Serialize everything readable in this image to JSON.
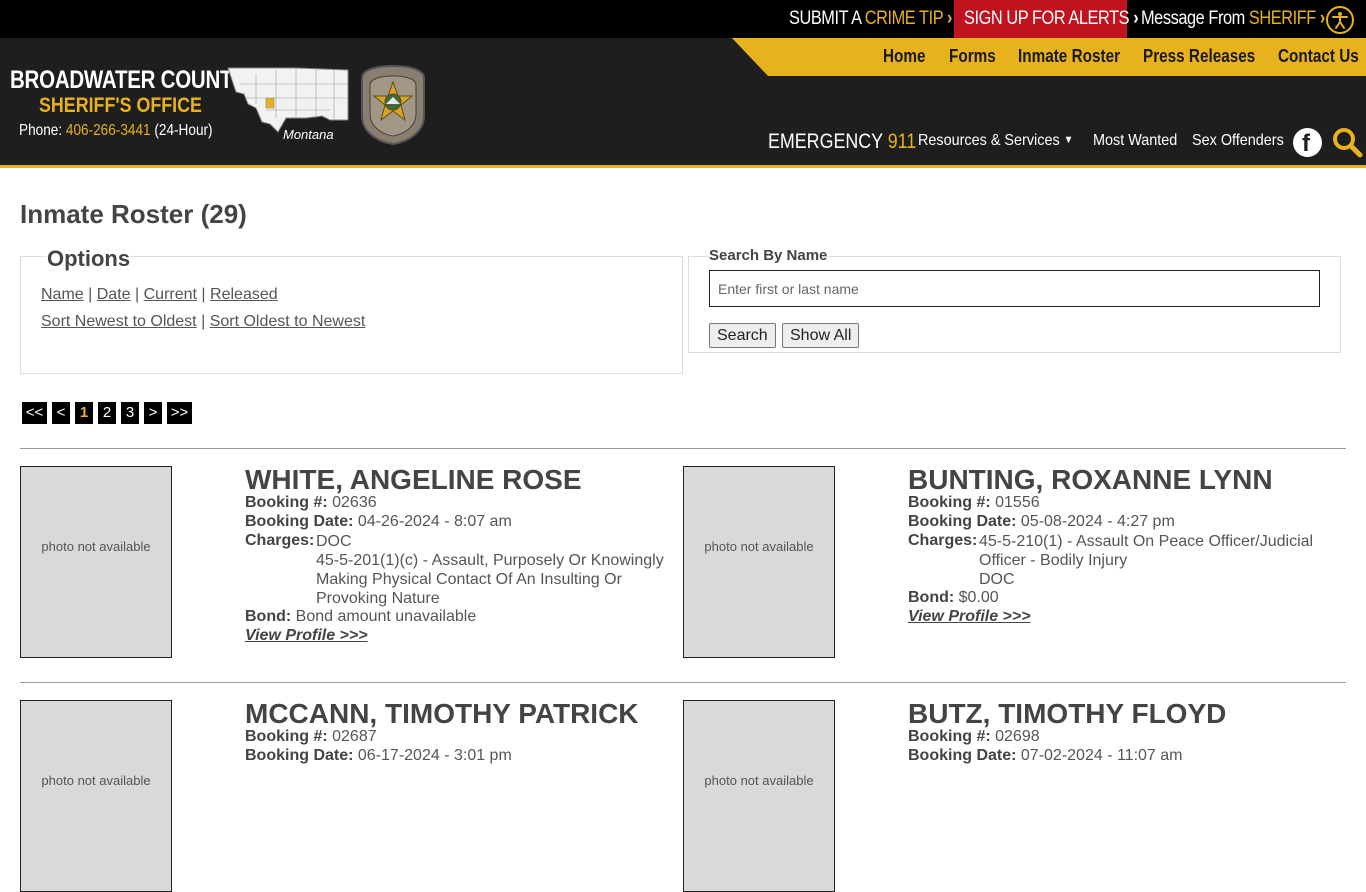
{
  "topbar": {
    "crime_tip_a": "SUBMIT A",
    "crime_tip_b": "CRIME TIP",
    "alerts": "SIGN UP FOR ALERTS",
    "message_a": "Message From",
    "message_b": "SHERIFF",
    "chevron": "›"
  },
  "brand": {
    "line1": "BROADWATER COUNTY",
    "line2": "SHERIFF'S OFFICE",
    "phone_label": "Phone:",
    "phone": "406-266-3441",
    "phone_note": "(24-Hour)",
    "map_label": "Montana",
    "badge_text_top": "BROADWATER CO.",
    "badge_text_bottom": "SHERIFF'S OFFICE",
    "badge_number": "43"
  },
  "nav": {
    "main": [
      "Home",
      "Forms",
      "Inmate Roster",
      "Press Releases",
      "Contact Us"
    ],
    "emergency_a": "EMERGENCY",
    "emergency_b": "911",
    "secondary": [
      "Resources & Services",
      "Most Wanted",
      "Sex Offenders"
    ]
  },
  "page": {
    "title": "Inmate Roster (29)"
  },
  "options": {
    "legend": "Options",
    "row1": [
      "Name",
      "Date",
      "Current",
      "Released"
    ],
    "row2": [
      "Sort Newest to Oldest",
      "Sort Oldest to Newest"
    ],
    "sep": "|"
  },
  "search": {
    "legend": "Search By Name",
    "placeholder": "Enter first or last name",
    "search_button": "Search",
    "show_all_button": "Show All"
  },
  "pager": [
    "<<",
    "<",
    "1",
    "2",
    "3",
    ">",
    ">>"
  ],
  "labels": {
    "booking_no": "Booking #:",
    "booking_date": "Booking Date:",
    "charges": "Charges:",
    "bond": "Bond:",
    "view_profile": "View Profile >>>",
    "photo_na": "photo not available"
  },
  "inmates": [
    {
      "name": "WHITE, ANGELINE ROSE",
      "booking_no": "02636",
      "booking_date": "04-26-2024 - 8:07 am",
      "charges": [
        "DOC",
        "45-5-201(1)(c) - Assault, Purposely Or Knowingly Making Physical Contact Of An Insulting Or Provoking Nature"
      ],
      "bond": "Bond amount unavailable"
    },
    {
      "name": "BUNTING, ROXANNE LYNN",
      "booking_no": "01556",
      "booking_date": "05-08-2024 - 4:27 pm",
      "charges": [
        "45-5-210(1) - Assault On Peace Officer/Judicial Officer - Bodily Injury",
        "DOC"
      ],
      "bond": "$0.00"
    },
    {
      "name": "MCCANN, TIMOTHY PATRICK",
      "booking_no": "02687",
      "booking_date": "06-17-2024 - 3:01 pm"
    },
    {
      "name": "BUTZ, TIMOTHY FLOYD",
      "booking_no": "02698",
      "booking_date": "07-02-2024 - 11:07 am"
    }
  ],
  "colors": {
    "gold": "#e8b21c",
    "alert_red": "#c0121f",
    "header_dark": "#1e1e1e"
  }
}
